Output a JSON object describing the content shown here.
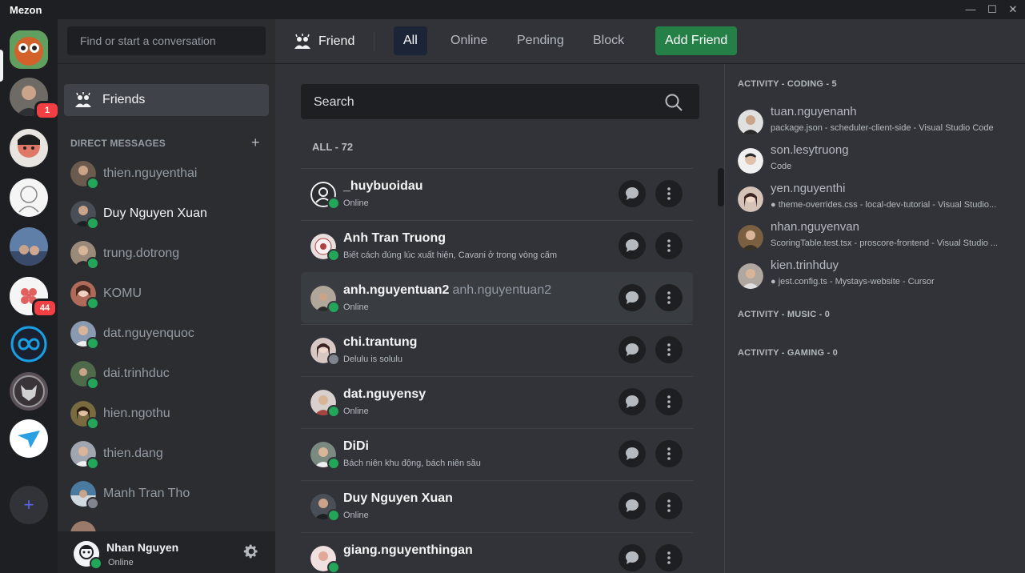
{
  "app": {
    "title": "Mezon"
  },
  "window_controls": {
    "minimize": "—",
    "maximize": "☐",
    "close": "✕"
  },
  "servers": {
    "badges": [
      "1",
      "44"
    ],
    "add_label": "+"
  },
  "dm_panel": {
    "search_placeholder": "Find or start a conversation",
    "friends_label": "Friends",
    "direct_messages_header": "DIRECT MESSAGES",
    "add_dm": "+",
    "items": [
      {
        "name": "thien.nguyenthai",
        "status": "online",
        "color": "#6b5a4e"
      },
      {
        "name": "Duy Nguyen Xuan",
        "status": "online",
        "color": "#4a4f57"
      },
      {
        "name": "trung.dotrong",
        "status": "online",
        "color": "#9a8a7a"
      },
      {
        "name": "KOMU",
        "status": "online",
        "color": "#b06a5a"
      },
      {
        "name": "dat.nguyenquoc",
        "status": "online",
        "color": "#8a9ab0"
      },
      {
        "name": "dai.trinhduc",
        "status": "online",
        "color": "#4e6a4a"
      },
      {
        "name": "hien.ngothu",
        "status": "online",
        "color": "#7a6a40"
      },
      {
        "name": "thien.dang",
        "status": "online",
        "color": "#a0a6b0"
      },
      {
        "name": "Manh Tran Tho",
        "status": "idle",
        "color": "#4a7aa0"
      }
    ]
  },
  "user": {
    "name": "Nhan Nguyen",
    "status": "Online"
  },
  "topbar": {
    "friend_label": "Friend",
    "tabs": [
      "All",
      "Online",
      "Pending",
      "Block"
    ],
    "add_friend": "Add Friend"
  },
  "list": {
    "search_placeholder": "Search",
    "count_label": "ALL - 72",
    "friends": [
      {
        "name": "_huybuoidau",
        "tag": "",
        "sub": "Online",
        "status": "online",
        "color": "#2b2d31"
      },
      {
        "name": "Anh Tran Truong",
        "tag": "",
        "sub": "Biết cách đúng lúc xuất hiện, Cavani ở trong vòng cấm",
        "status": "online",
        "color": "#e8dede"
      },
      {
        "name": "anh.nguyentuan2",
        "tag": "anh.nguyentuan2",
        "sub": "Online",
        "status": "online",
        "color": "#b0a79a"
      },
      {
        "name": "chi.trantung",
        "tag": "",
        "sub": "Delulu is solulu",
        "status": "idle",
        "color": "#d8c8c4"
      },
      {
        "name": "dat.nguyensy",
        "tag": "",
        "sub": "Online",
        "status": "online",
        "color": "#a4463e"
      },
      {
        "name": "DiDi",
        "tag": "",
        "sub": "Bách niên khu động, bách niên sầu",
        "status": "online",
        "color": "#7a8a80"
      },
      {
        "name": "Duy Nguyen Xuan",
        "tag": "",
        "sub": "Online",
        "status": "online",
        "color": "#4a4f57"
      },
      {
        "name": "giang.nguyenthingan",
        "tag": "",
        "sub": "",
        "status": "online",
        "color": "#d0a0a0"
      }
    ]
  },
  "activity": {
    "coding_header": "ACTIVITY - CODING - 5",
    "music_header": "ACTIVITY - MUSIC - 0",
    "gaming_header": "ACTIVITY - GAMING - 0",
    "coding": [
      {
        "name": "tuan.nguyenanh",
        "desc": "package.json - scheduler-client-side - Visual Studio Code",
        "color": "#555a60"
      },
      {
        "name": "son.lesytruong",
        "desc": "Code",
        "color": "#c8b8a8"
      },
      {
        "name": "yen.nguyenthi",
        "desc": "● theme-overrides.css - local-dev-tutorial - Visual Studio...",
        "color": "#d6c3b8"
      },
      {
        "name": "nhan.nguyenvan",
        "desc": "ScoringTable.test.tsx - proscore-frontend - Visual Studio ...",
        "color": "#7a6040"
      },
      {
        "name": "kien.trinhduy",
        "desc": "● jest.config.ts - Mystays-website - Cursor",
        "color": "#b0a8a0"
      }
    ]
  }
}
